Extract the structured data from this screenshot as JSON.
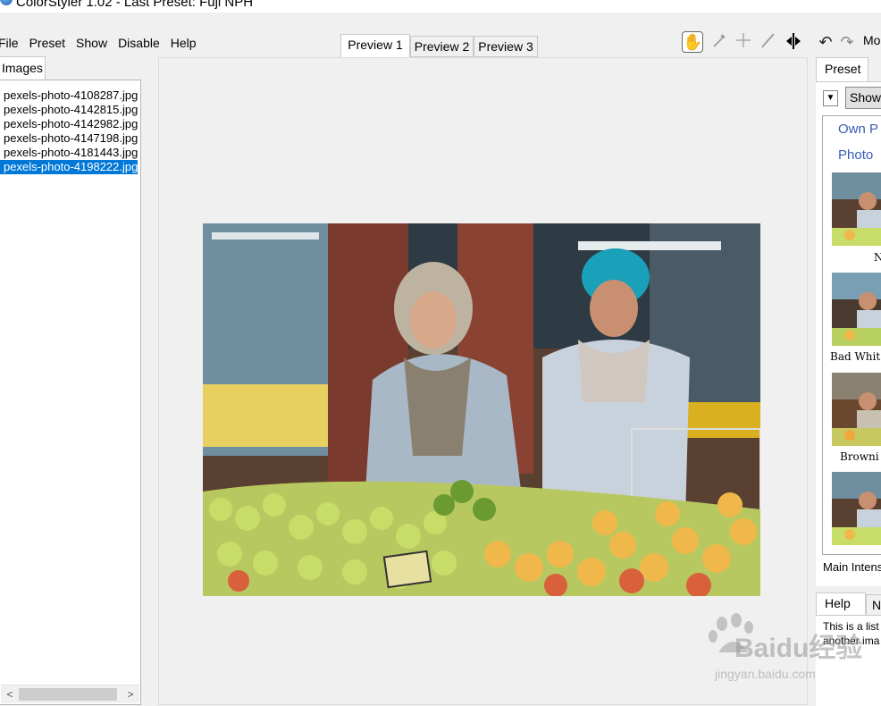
{
  "window": {
    "title": "ColorStyler 1.02 - Last Preset: Fuji NPH"
  },
  "menu": [
    "File",
    "Preset",
    "Show",
    "Disable",
    "Help"
  ],
  "left_panel": {
    "tab": "Images",
    "files": [
      "pexels-photo-4108287.jpg",
      "pexels-photo-4142815.jpg",
      "pexels-photo-4142982.jpg",
      "pexels-photo-4147198.jpg",
      "pexels-photo-4181443.jpg",
      "pexels-photo-4198222.jpg"
    ],
    "selected_index": 5
  },
  "preview_tabs": [
    "Preview 1",
    "Preview 2",
    "Preview 3"
  ],
  "active_preview_tab": "Preview 1",
  "toolbar_icons": [
    "hand-icon",
    "eyedropper-icon",
    "crosshair-icon",
    "brush-icon",
    "split-view-icon",
    "undo-icon",
    "redo-icon"
  ],
  "toolbar_truncated_label": "Mo",
  "right_panel": {
    "tab": "Preset",
    "show_button": "Show",
    "categories": [
      "Own P",
      "Photo"
    ],
    "presets": [
      "N",
      "Bad Whit",
      "Browni"
    ],
    "main_intensity_label": "Main Intens",
    "help_tab": "Help",
    "second_tab": "N",
    "help_text": [
      "This is a list",
      "another ima"
    ]
  },
  "watermark": {
    "text": "Baidu经验",
    "url": "jingyan.baidu.com"
  },
  "colors": {
    "selection": "#0078d7",
    "category_text": "#3a5bb5"
  }
}
